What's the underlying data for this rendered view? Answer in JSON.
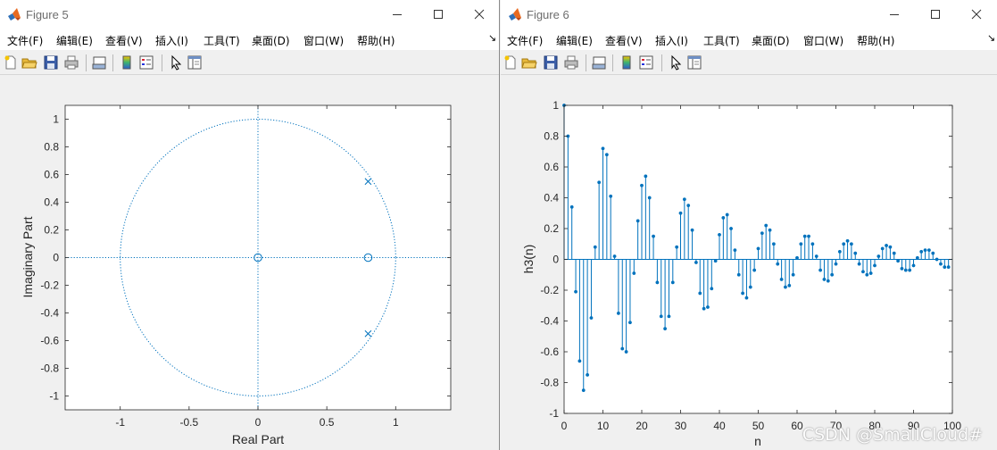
{
  "colors": {
    "plot": "#0072bd",
    "axis": "#262626",
    "titlebar": "#ffffff",
    "figure_bg": "#f0f0f0"
  },
  "icons": [
    "matlab-logo-icon",
    "minimize-icon",
    "maximize-icon",
    "close-icon",
    "new-figure-icon",
    "open-file-icon",
    "save-icon",
    "print-icon",
    "link-plot-icon",
    "colorbar-icon",
    "legend-icon",
    "pointer-icon",
    "property-inspector-icon"
  ],
  "menus": [
    {
      "label": "文件(F)"
    },
    {
      "label": "编辑(E)"
    },
    {
      "label": "查看(V)"
    },
    {
      "label": "插入(I)"
    },
    {
      "label": "工具(T)"
    },
    {
      "label": "桌面(D)"
    },
    {
      "label": "窗口(W)"
    },
    {
      "label": "帮助(H)"
    }
  ],
  "menu_overflow": "↘",
  "figure5": {
    "title": "Figure 5",
    "chart_data": {
      "type": "scatter",
      "title": "",
      "xlabel": "Real Part",
      "ylabel": "Imaginary Part",
      "xlim": [
        -1.4,
        1.4
      ],
      "ylim": [
        -1.1,
        1.1
      ],
      "xticks": [
        -1,
        -0.5,
        0,
        0.5,
        1
      ],
      "xticklabels": [
        "-1",
        "-0.5",
        "0",
        "0.5",
        "1"
      ],
      "yticks": [
        1,
        0.8,
        0.6,
        0.4,
        0.2,
        0,
        -0.2,
        -0.4,
        -0.6,
        -0.8,
        -1
      ],
      "yticklabels": [
        "1",
        "0.8",
        "0.6",
        "0.4",
        "0.2",
        "0",
        "-0.2",
        "-0.4",
        "-0.6",
        "-0.8",
        "-1"
      ],
      "unit_circle": true,
      "series": [
        {
          "marker": "o",
          "points": [
            [
              0,
              0
            ],
            [
              0.8,
              0
            ]
          ]
        },
        {
          "marker": "x",
          "points": [
            [
              0.8,
              0.55
            ],
            [
              0.8,
              -0.55
            ]
          ]
        }
      ]
    }
  },
  "figure6": {
    "title": "Figure 6",
    "chart_data": {
      "type": "stem",
      "title": "",
      "xlabel": "n",
      "ylabel": "h3(n)",
      "xlim": [
        0,
        100
      ],
      "ylim": [
        -1,
        1
      ],
      "xticks": [
        0,
        10,
        20,
        30,
        40,
        50,
        60,
        70,
        80,
        90,
        100
      ],
      "xticklabels": [
        "0",
        "10",
        "20",
        "30",
        "40",
        "50",
        "60",
        "70",
        "80",
        "90",
        "100"
      ],
      "yticks": [
        1,
        0.8,
        0.6,
        0.4,
        0.2,
        0,
        -0.2,
        -0.4,
        -0.6,
        -0.8,
        -1
      ],
      "yticklabels": [
        "1",
        "0.8",
        "0.6",
        "0.4",
        "0.2",
        "0",
        "-0.2",
        "-0.4",
        "-0.6",
        "-0.8",
        "-1"
      ],
      "x": [
        0,
        1,
        2,
        3,
        4,
        5,
        6,
        7,
        8,
        9,
        10,
        11,
        12,
        13,
        14,
        15,
        16,
        17,
        18,
        19,
        20,
        21,
        22,
        23,
        24,
        25,
        26,
        27,
        28,
        29,
        30,
        31,
        32,
        33,
        34,
        35,
        36,
        37,
        38,
        39,
        40,
        41,
        42,
        43,
        44,
        45,
        46,
        47,
        48,
        49,
        50,
        51,
        52,
        53,
        54,
        55,
        56,
        57,
        58,
        59,
        60,
        61,
        62,
        63,
        64,
        65,
        66,
        67,
        68,
        69,
        70,
        71,
        72,
        73,
        74,
        75,
        76,
        77,
        78,
        79,
        80,
        81,
        82,
        83,
        84,
        85,
        86,
        87,
        88,
        89,
        90,
        91,
        92,
        93,
        94,
        95,
        96,
        97,
        98,
        99
      ],
      "values": [
        1.0,
        0.8,
        0.34,
        -0.21,
        -0.66,
        -0.85,
        -0.75,
        -0.38,
        0.08,
        0.5,
        0.72,
        0.68,
        0.41,
        0.02,
        -0.35,
        -0.58,
        -0.6,
        -0.41,
        -0.09,
        0.25,
        0.48,
        0.54,
        0.4,
        0.15,
        -0.15,
        -0.37,
        -0.45,
        -0.37,
        -0.15,
        0.08,
        0.3,
        0.39,
        0.35,
        0.19,
        -0.02,
        -0.22,
        -0.32,
        -0.31,
        -0.19,
        -0.01,
        0.16,
        0.27,
        0.29,
        0.2,
        0.06,
        -0.1,
        -0.22,
        -0.25,
        -0.18,
        -0.07,
        0.07,
        0.17,
        0.22,
        0.19,
        0.1,
        -0.03,
        -0.13,
        -0.18,
        -0.17,
        -0.1,
        0.01,
        0.1,
        0.15,
        0.15,
        0.1,
        0.02,
        -0.07,
        -0.13,
        -0.14,
        -0.1,
        -0.03,
        0.05,
        0.1,
        0.12,
        0.1,
        0.04,
        -0.03,
        -0.08,
        -0.1,
        -0.09,
        -0.04,
        0.02,
        0.07,
        0.09,
        0.08,
        0.04,
        -0.01,
        -0.06,
        -0.07,
        -0.07,
        -0.04,
        0.01,
        0.05,
        0.06,
        0.06,
        0.04,
        0.0,
        -0.03,
        -0.05,
        -0.05
      ]
    }
  },
  "watermark": "CSDN @SmallCloud#"
}
